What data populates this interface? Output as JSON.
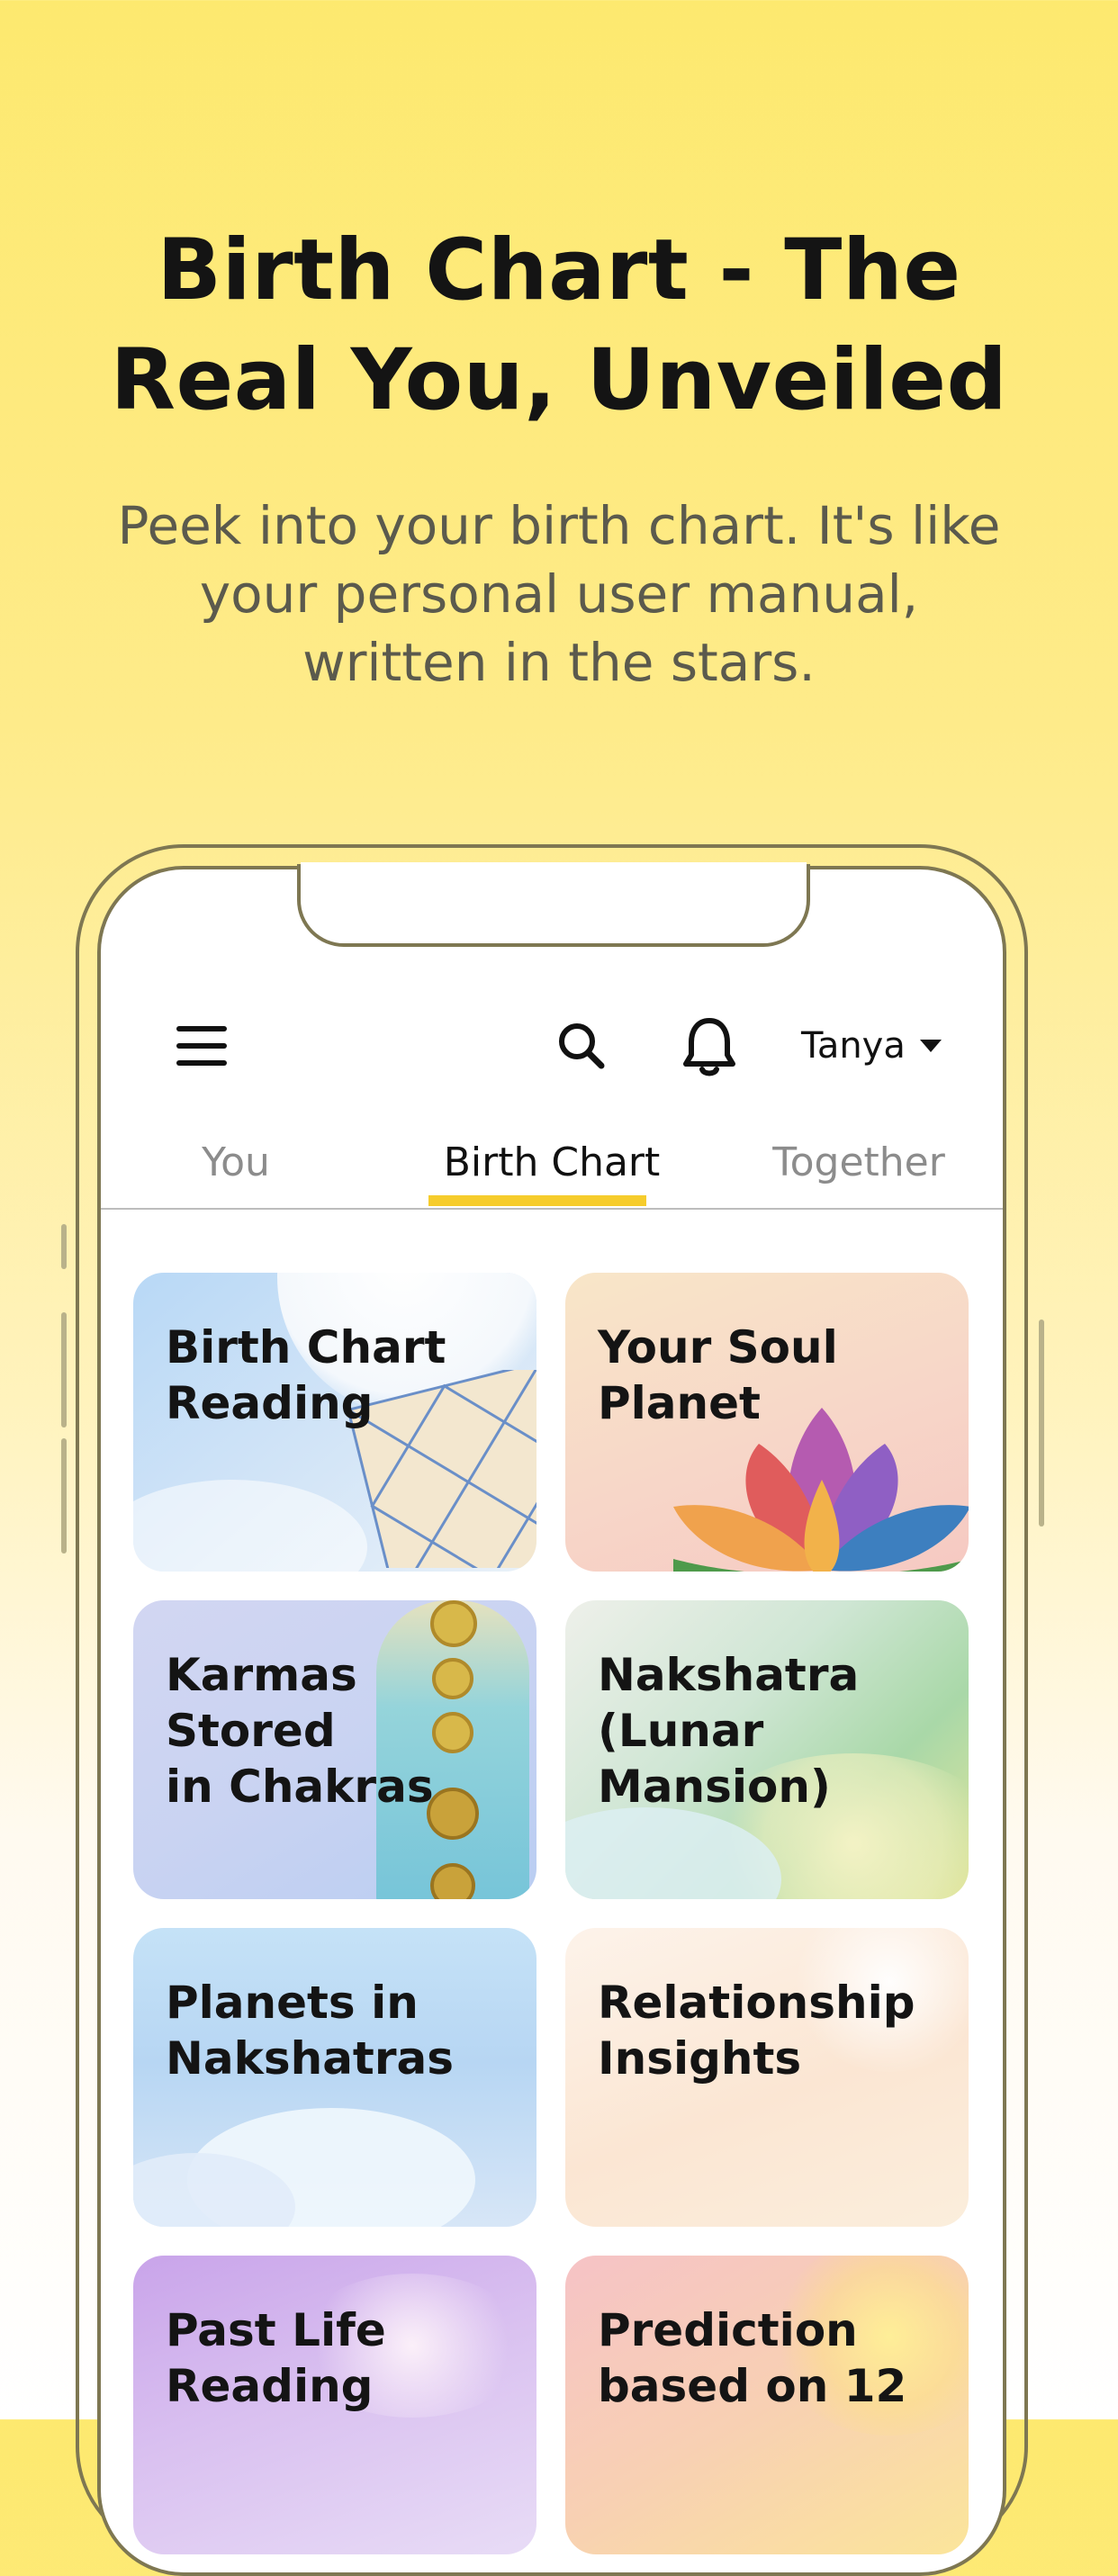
{
  "hero": {
    "title": "Birth Chart - The\nReal You, Unveiled",
    "subtitle": "Peek into your birth chart. It's like your personal user manual, written in the stars."
  },
  "header": {
    "menu_icon": "hamburger-menu-icon",
    "search_icon": "search-icon",
    "notification_icon": "bell-icon",
    "user_name": "Tanya",
    "user_caret_icon": "caret-down-icon"
  },
  "tabs": [
    {
      "label": "You",
      "active": false
    },
    {
      "label": "Birth Chart",
      "active": true
    },
    {
      "label": "Together",
      "active": false
    }
  ],
  "accent_color": "#f6cc2c",
  "cards": [
    {
      "title": "Birth Chart\nReading"
    },
    {
      "title": "Your Soul\nPlanet"
    },
    {
      "title": "Karmas Stored\nin Chakras"
    },
    {
      "title": "Nakshatra\n(Lunar\nMansion)"
    },
    {
      "title": "Planets in\nNakshatras"
    },
    {
      "title": "Relationship\nInsights"
    },
    {
      "title": "Past Life\nReading"
    },
    {
      "title": "Prediction\nbased on 12"
    }
  ]
}
